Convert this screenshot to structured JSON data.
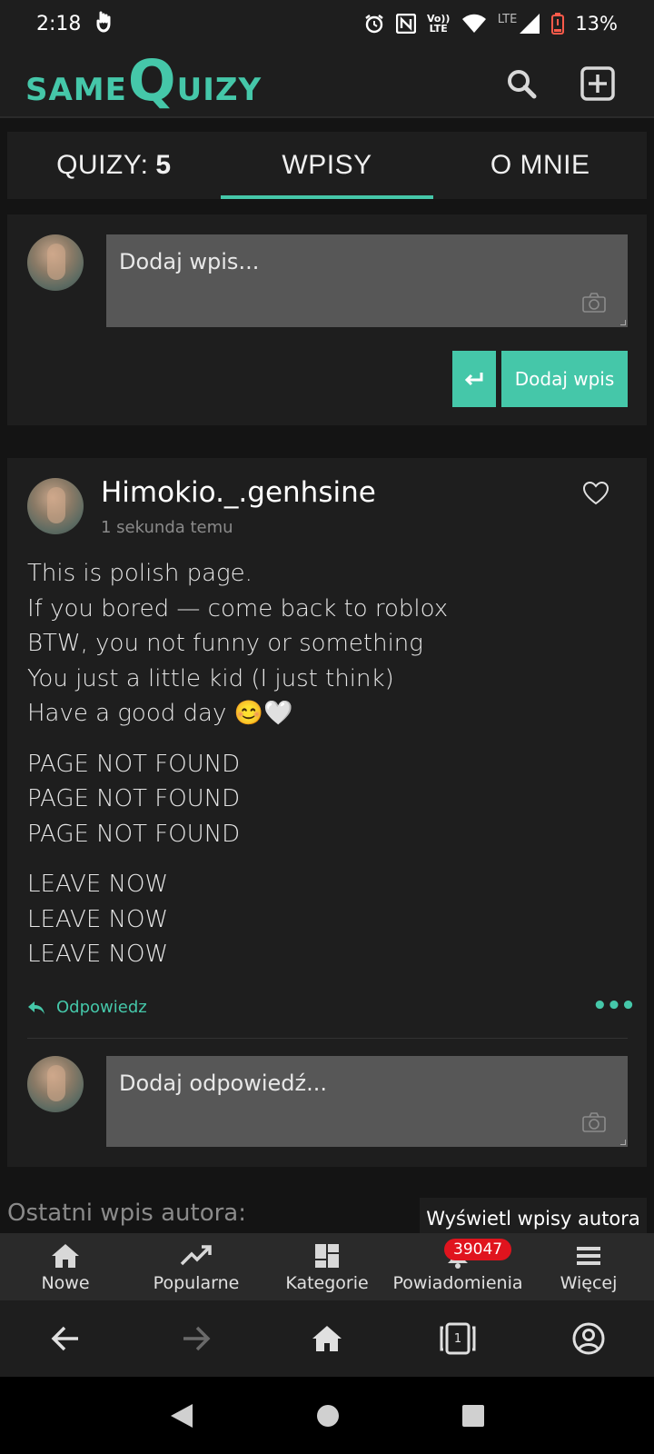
{
  "status_bar": {
    "time": "2:18",
    "network_label": "LTE",
    "volte_label": "Vo)) LTE",
    "battery": "13%"
  },
  "header": {
    "logo_same": "SAME",
    "logo_q": "Q",
    "logo_uizy": "UIZY",
    "search_icon": "search-icon",
    "add_icon": "plus-square-icon",
    "accent_color": "#45c7a9"
  },
  "tabs": [
    {
      "label": "QUIZY:",
      "count": "5"
    },
    {
      "label": "WPISY",
      "active": true
    },
    {
      "label": "O MNIE"
    }
  ],
  "composer": {
    "placeholder": "Dodaj wpis...",
    "submit_label": "Dodaj wpis"
  },
  "post": {
    "username": "Himokio._.genhsine",
    "timestamp": "1 sekunda temu",
    "paragraphs": [
      [
        "This is polish page.",
        "If you bored — come back to roblox",
        "BTW, you not funny or something",
        "You just a little kid (I just think)",
        "Have a good day 😊🤍"
      ],
      [
        "PAGE NOT FOUND",
        "PAGE NOT FOUND",
        "PAGE NOT FOUND"
      ],
      [
        "LEAVE NOW",
        "LEAVE NOW",
        "LEAVE NOW"
      ]
    ],
    "reply_label": "Odpowiedz",
    "more_label": "•••",
    "reply_placeholder": "Dodaj odpowiedź..."
  },
  "footer": {
    "last_entry_label": "Ostatni wpis autora:",
    "view_entries_label": "Wyświetl wpisy autora"
  },
  "app_nav": [
    {
      "label": "Nowe",
      "icon": "home-icon"
    },
    {
      "label": "Popularne",
      "icon": "trending-icon"
    },
    {
      "label": "Kategorie",
      "icon": "dashboard-icon"
    },
    {
      "label": "Powiadomienia",
      "icon": "bell-icon",
      "badge": "39047"
    },
    {
      "label": "Więcej",
      "icon": "menu-icon"
    }
  ],
  "browser_nav": {
    "tabs_count": "1"
  }
}
